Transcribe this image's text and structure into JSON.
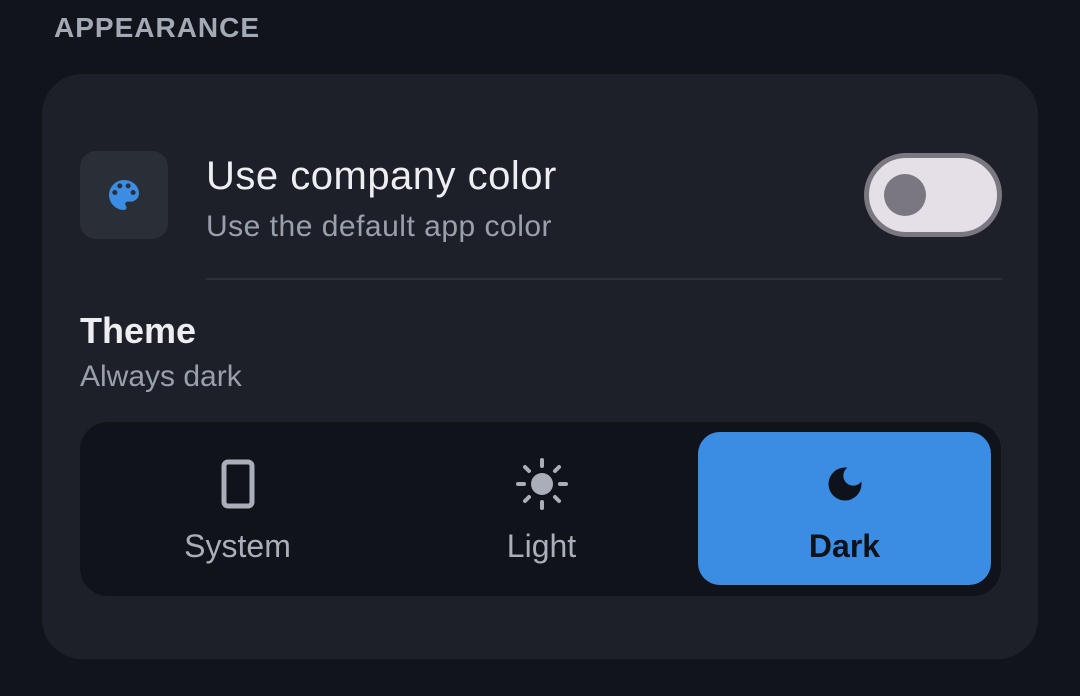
{
  "section": {
    "header": "APPEARANCE"
  },
  "company_color": {
    "title": "Use company color",
    "subtitle": "Use the default app color",
    "icon": "palette-icon",
    "toggle_on": false
  },
  "theme": {
    "title": "Theme",
    "subtitle": "Always dark",
    "options": [
      {
        "label": "System",
        "icon": "phone-icon",
        "selected": false
      },
      {
        "label": "Light",
        "icon": "sun-icon",
        "selected": false
      },
      {
        "label": "Dark",
        "icon": "moon-icon",
        "selected": true
      }
    ]
  },
  "colors": {
    "accent": "#3b8de4",
    "card": "#1d2029",
    "background": "#11141a"
  }
}
